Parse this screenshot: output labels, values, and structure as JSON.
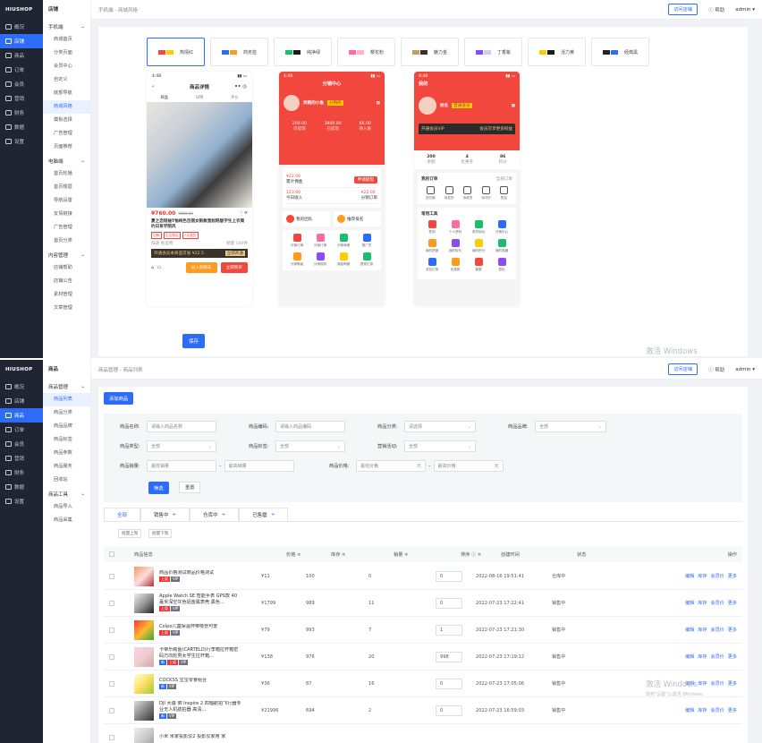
{
  "screen1": {
    "logo": "HIUSHOP",
    "sidebar": [
      "概况",
      "店铺",
      "商品",
      "订单",
      "会员",
      "营销",
      "财务",
      "数据",
      "设置"
    ],
    "sub_head": "店铺",
    "sub_groups": [
      {
        "label": "手机端",
        "items": [
          "商城首页",
          "分类页面",
          "会员中心",
          "自定义",
          "底部导航",
          "商城风格",
          "模板选择",
          "广告管理",
          "页面推荐"
        ]
      },
      {
        "label": "电脑端",
        "items": [
          "首页轮播",
          "首页楼层",
          "导航设置",
          "友情链接",
          "广告管理",
          "首页分类"
        ]
      },
      {
        "label": "内容管理",
        "items": [
          "店铺帮助",
          "店铺公告",
          "素材管理",
          "文章管理"
        ]
      }
    ],
    "breadcrumb": "手机端 - 商城风格",
    "visit_store": "访问店铺",
    "help": "帮助",
    "user": "admin",
    "themes": [
      {
        "name": "热情红",
        "c1": "#f2473d",
        "c2": "#ffcc00"
      },
      {
        "name": "商务蓝",
        "c1": "#2d6cf6",
        "c2": "#ff9a1f"
      },
      {
        "name": "纯净绿",
        "c1": "#19be6b",
        "c2": "#1a1a1a"
      },
      {
        "name": "樱花粉",
        "c1": "#ff6aa0",
        "c2": "#ffb0ca"
      },
      {
        "name": "魅力金",
        "c1": "#c89a5b",
        "c2": "#333333"
      },
      {
        "name": "丁香紫",
        "c1": "#8b4cf6",
        "c2": "#d8c6ff"
      },
      {
        "name": "活力黄",
        "c1": "#ffcc00",
        "c2": "#1a1a1a"
      },
      {
        "name": "经典黑",
        "c1": "#222222",
        "c2": "#2d6cf6"
      }
    ],
    "phone1": {
      "time": "4:48",
      "title": "商品详情",
      "tabs": [
        "商品",
        "详情",
        "评价"
      ],
      "price": "¥760.00",
      "old_price": "¥880.00",
      "desc": "夏之恋短袖T恤纯色百搭女新款宽松韩版学生上衣简约日系学院风",
      "add_cart": "加入购物车",
      "buy_now": "立即购买",
      "shipping": "快递 免运费",
      "sales": "销量 100件",
      "coupon": "开通会员本商品可省 ¥22.5",
      "coupon_btn": "立即开通",
      "tags": [
        "包邮",
        "正品保证",
        "7天退货"
      ]
    },
    "phone2": {
      "time": "4:48",
      "title": "分销中心",
      "name": "奔跑的小鱼",
      "level": "分销商",
      "stats": [
        {
          "v": "200.00",
          "l": "可提现"
        },
        {
          "v": "3900.00",
          "l": "已提现"
        },
        {
          "v": "66.00",
          "l": "待入账"
        }
      ],
      "rows": [
        {
          "a": "¥22.00",
          "al": "累计佣金",
          "b": "申请提现"
        },
        {
          "a": "123.00",
          "al": "今日收入",
          "b": "¥22.00",
          "bl": "分销订单"
        }
      ],
      "team": "我的团队",
      "rank": "推荐排名",
      "menu": [
        "分销订单",
        "分销订单",
        "分销海报",
        "推广员",
        "分销等级",
        "分销规则",
        "佣金明细",
        "提现记录"
      ]
    },
    "phone3": {
      "time": "4:48",
      "title": "我的",
      "name": "姓名",
      "level": "普通会员",
      "vip": "开通会员VIP",
      "vip_btn": "会员可享更多权益",
      "stats": [
        {
          "v": "200",
          "l": "余额"
        },
        {
          "v": "4",
          "l": "优惠券"
        },
        {
          "v": "86",
          "l": "积分"
        }
      ],
      "orders_title": "我的订单",
      "orders_more": "全部订单",
      "orders": [
        "待付款",
        "待发货",
        "待收货",
        "待评价",
        "售后"
      ],
      "tools_title": "常用工具",
      "tools": [
        "签到",
        "个人资料",
        "收货地址",
        "分销中心",
        "我的拼团",
        "我的砍价",
        "我的积分",
        "我的收藏",
        "浏览记录",
        "优惠券",
        "客服",
        "退出"
      ]
    },
    "save": "保存",
    "watermark": "激活 Windows"
  },
  "screen2": {
    "logo": "HIUSHOP",
    "sidebar": [
      "概况",
      "店铺",
      "商品",
      "订单",
      "会员",
      "营销",
      "财务",
      "数据",
      "设置"
    ],
    "sub_head": "商品",
    "sub_groups": [
      {
        "label": "商品管理",
        "items": [
          "商品列表",
          "商品分类",
          "商品品牌",
          "商品标签",
          "商品参数",
          "商品服务",
          "回收站"
        ]
      },
      {
        "label": "商品工具",
        "items": [
          "商品导入",
          "商品采集"
        ]
      }
    ],
    "breadcrumb": "商品管理 - 商品列表",
    "visit_store": "访问店铺",
    "help": "帮助",
    "user": "admin",
    "add_btn": "添加商品",
    "filters": {
      "name_label": "商品名称:",
      "name_ph": "请输入商品名称",
      "code_label": "商品编码:",
      "code_ph": "请输入商品编码",
      "cat_label": "商品分类:",
      "cat_ph": "请选择",
      "brand_label": "商品品牌:",
      "brand_val": "全部",
      "type_label": "商品类型:",
      "type_val": "全部",
      "tag_label": "商品标签:",
      "tag_val": "全部",
      "spec_label": "营销活动:",
      "spec_val": "全部",
      "sales_label": "商品销量:",
      "sales_min": "最低销量",
      "sales_max": "最高销量",
      "price_label": "商品价格:",
      "price_min": "最低价格",
      "price_max": "最高价格",
      "unit": "元"
    },
    "filter_btn": "筛选",
    "reset_btn": "重置",
    "tabs": [
      "全部",
      "销售中",
      "仓库中",
      "已售罄"
    ],
    "batch": [
      "批量上架",
      "批量下架"
    ],
    "columns": [
      "商品信息",
      "价格 ≑",
      "库存 ≑",
      "销量 ≑",
      "排序 ⓘ ≑",
      "创建时间",
      "状态",
      "操作"
    ],
    "rows": [
      {
        "name": "商品价格测试商品价格测试",
        "tags": [
          "上架",
          "VIP"
        ],
        "price": "¥11",
        "stock": "100",
        "sales": "0",
        "sort": "0",
        "time": "2022-08-16 19:51:41",
        "status": "仓库中"
      },
      {
        "name": "Apple Watch SE 智能手表 GPS款 40毫米深空灰色铝金属表壳 黑色...",
        "tags": [
          "上架",
          "VIP"
        ],
        "price": "¥1799",
        "stock": "989",
        "sales": "11",
        "sort": "0",
        "time": "2022-07-23 17:22:41",
        "status": "销售中"
      },
      {
        "name": "Colpo儿童保温杯带吸管可爱",
        "tags": [
          "上架",
          "VIP"
        ],
        "price": "¥79",
        "stock": "993",
        "sales": "7",
        "sort": "1",
        "time": "2022-07-23 17:21:30",
        "status": "销售中"
      },
      {
        "name": "卡帝乐鳄鱼(CARTELO)行李箱拉杆箱密码万向轮男女学生拉杆箱...",
        "tags": [
          "新",
          "上架",
          "VIP"
        ],
        "price": "¥138",
        "stock": "976",
        "sales": "20",
        "sort": "998",
        "time": "2022-07-23 17:19:12",
        "status": "销售中"
      },
      {
        "name": "COCKSS 宝宝零食组合",
        "tags": [
          "新",
          "VIP"
        ],
        "price": "¥36",
        "stock": "87",
        "sales": "16",
        "sort": "0",
        "time": "2022-07-23 17:05:06",
        "status": "销售中"
      },
      {
        "name": "DJI 大疆 御 Inspire 2 四轴航拍飞行器专业无人机航拍器 高清...",
        "tags": [
          "新",
          "VIP"
        ],
        "price": "¥21996",
        "stock": "694",
        "sales": "2",
        "sort": "0",
        "time": "2022-07-23 16:59:03",
        "status": "销售中"
      },
      {
        "name": "小米 米家投影仪2 投影仪家用 家",
        "tags": [],
        "price": "",
        "stock": "",
        "sales": "",
        "sort": "",
        "time": "",
        "status": ""
      }
    ],
    "ops": [
      "编辑",
      "库存",
      "会员价",
      "更多"
    ],
    "watermark": "激活 Windows",
    "watermark_sub": "转到\"设置\"以激活 Windows。"
  }
}
